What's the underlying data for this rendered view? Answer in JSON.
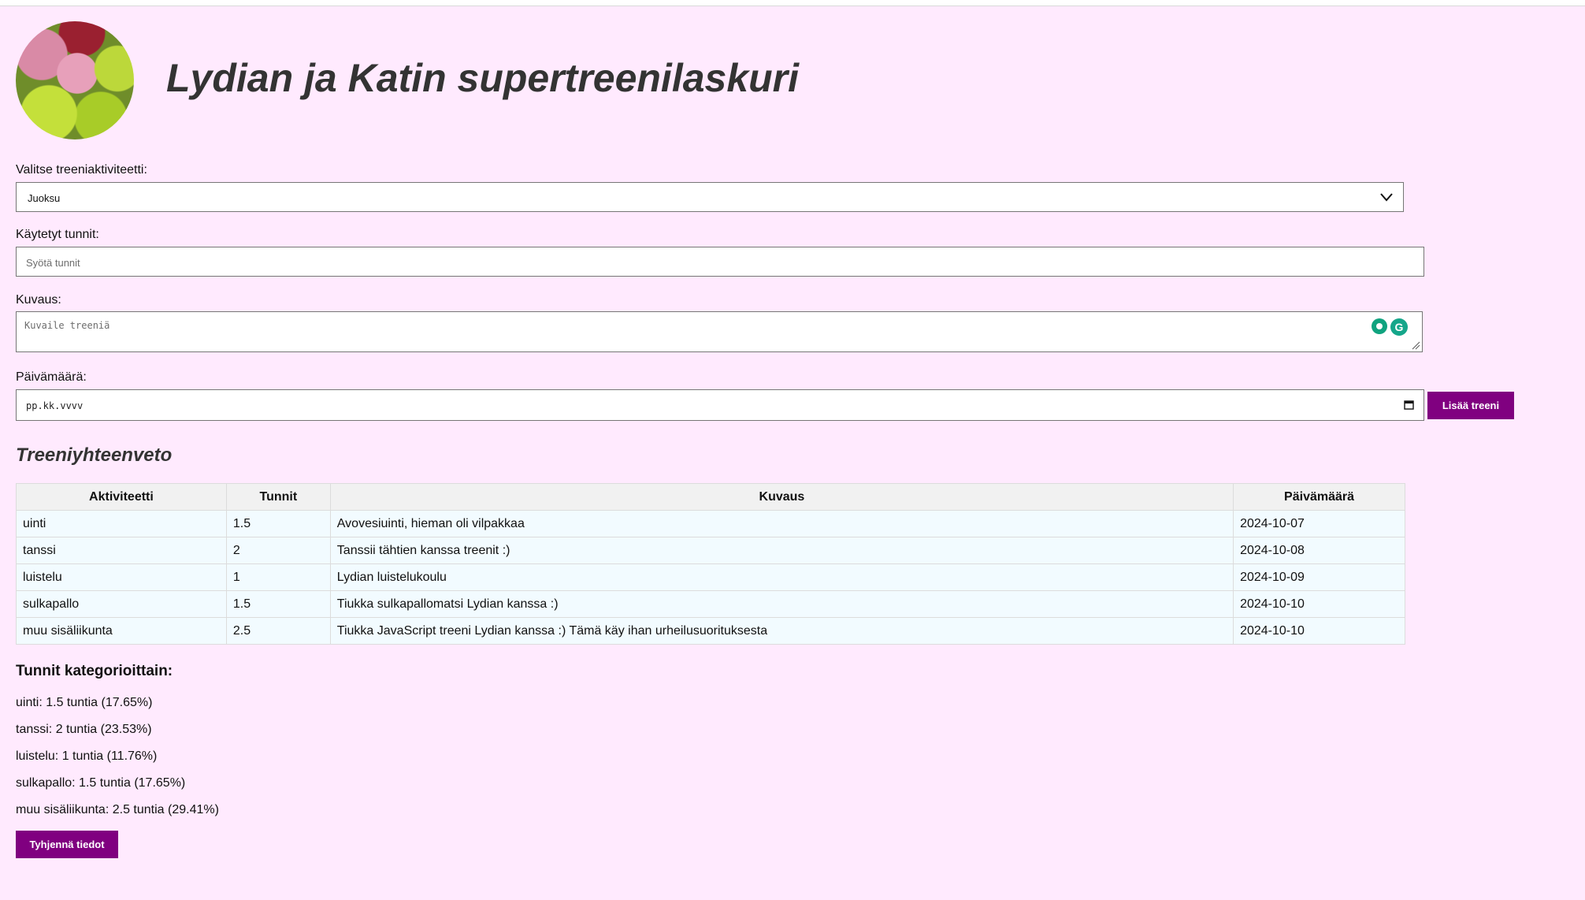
{
  "header": {
    "title": "Lydian ja Katin supertreenilaskuri"
  },
  "form": {
    "activity_label": "Valitse treeniaktiviteetti:",
    "activity_selected": "Juoksu",
    "hours_label": "Käytetyt tunnit:",
    "hours_placeholder": "Syötä tunnit",
    "description_label": "Kuvaus:",
    "description_placeholder": "Kuvaile treeniä",
    "date_label": "Päivämäärä:",
    "date_placeholder": "pp.kk.vvvv",
    "add_button": "Lisää treeni"
  },
  "summary": {
    "title": "Treeniyhteenveto",
    "columns": [
      "Aktiviteetti",
      "Tunnit",
      "Kuvaus",
      "Päivämäärä"
    ],
    "rows": [
      [
        "uinti",
        "1.5",
        "Avovesiuinti, hieman oli vilpakkaa",
        "2024-10-07"
      ],
      [
        "tanssi",
        "2",
        "Tanssii tähtien kanssa treenit :)",
        "2024-10-08"
      ],
      [
        "luistelu",
        "1",
        "Lydian luistelukoulu",
        "2024-10-09"
      ],
      [
        "sulkapallo",
        "1.5",
        "Tiukka sulkapallomatsi Lydian kanssa :)",
        "2024-10-10"
      ],
      [
        "muu sisäliikunta",
        "2.5",
        "Tiukka JavaScript treeni Lydian kanssa :) Tämä käy ihan urheilusuorituksesta",
        "2024-10-10"
      ]
    ]
  },
  "categories": {
    "title": "Tunnit kategorioittain:",
    "items": [
      "uinti: 1.5 tuntia (17.65%)",
      "tanssi: 2 tuntia (23.53%)",
      "luistelu: 1 tuntia (11.76%)",
      "sulkapallo: 1.5 tuntia (17.65%)",
      "muu sisäliikunta: 2.5 tuntia (29.41%)"
    ],
    "clear_button": "Tyhjennä tiedot"
  },
  "colors": {
    "background": "#ffeafe",
    "accent": "#800080"
  },
  "icons": {
    "select_arrow": "chevron-down-icon",
    "date_picker": "calendar-icon",
    "extension": "grammarly-icon"
  }
}
